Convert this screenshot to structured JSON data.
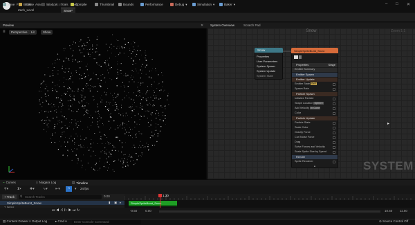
{
  "titlebar": {
    "menus": [
      "File",
      "Edit",
      "Asset",
      "Window",
      "Tools",
      "Help"
    ],
    "tabs": [
      "Zach_Level",
      "Snow*"
    ]
  },
  "toolbar": {
    "save": "Save",
    "browse": "Browse",
    "apply_scratch": "Apply Scratch",
    "compile": "Compile",
    "thumbnail": "Thumbnail",
    "bounds": "Bounds",
    "performance": "Performance",
    "debug": "Debug",
    "simulation": "Simulation",
    "baker": "Baker"
  },
  "preview": {
    "tab": "Preview",
    "perspective": "Perspective",
    "lit": "Lit",
    "show": "Show"
  },
  "graph": {
    "tabs": [
      "System Overview",
      "Scratch Pad"
    ],
    "title": "Snow",
    "zoom": "Zoom 1:1",
    "watermark": "SYSTEM"
  },
  "system_node": {
    "title": "Snow",
    "rows": [
      "Properties",
      "User Parameters",
      "System Spawn",
      "System Update",
      "System State"
    ]
  },
  "emitter_node": {
    "title": "SimpleSpriteBurst_Snow",
    "props": "Properties",
    "stage": "Stage",
    "summary": "Emitter Summary",
    "emitter_spawn": "Emitter Spawn",
    "emitter_update": "Emitter Update",
    "emitter_state": "Emitter State",
    "emitter_state_tag": "Self",
    "spawn_rate": "Spawn Rate",
    "particle_spawn": "Particle Spawn",
    "init_particle": "Initialize Particle",
    "shape_location": "Shape Location",
    "shape_location_tag": "Sphere",
    "add_velocity": "Add Velocity",
    "add_velocity_tag": "In Cone",
    "color": "Color",
    "particle_update": "Particle Update",
    "particle_state": "Particle State",
    "scale_color": "Scale Color",
    "gravity_force": "Gravity Force",
    "drag": "Drag",
    "curl_noise": "Curl Noise Force",
    "solve": "Solve Forces and Velocity",
    "scale_sprite": "Scale Sprite Size by Speed",
    "render": "Render",
    "sprite_renderer": "Sprite Renderer"
  },
  "bottom_tabs": [
    "Curves",
    "Niagara Log",
    "Timeline"
  ],
  "timeline": {
    "fps": "24 fps",
    "track_btn": "+ Track",
    "search": "Search Tracks",
    "item": "SimpleSpriteBurst_Snow",
    "count": "1 items",
    "start": "0.00",
    "time_left": "-0.50",
    "ruler": [
      "-0.50",
      "0.00",
      "0.50",
      "1.00",
      "1.50",
      "2.00",
      "2.50",
      "3.00",
      "3.50",
      "4.00",
      "4.50",
      "5.00",
      "5.50",
      "6.00",
      "6.50"
    ],
    "playhead": "1.30",
    "end_a": "10.50",
    "end_b": "11.50"
  },
  "status": {
    "content_drawer": "Content Drawer",
    "output_log": "Output Log",
    "cmd": "Cmd",
    "console_placeholder": "Enter Console Command",
    "source_control": "Source Control Off"
  }
}
